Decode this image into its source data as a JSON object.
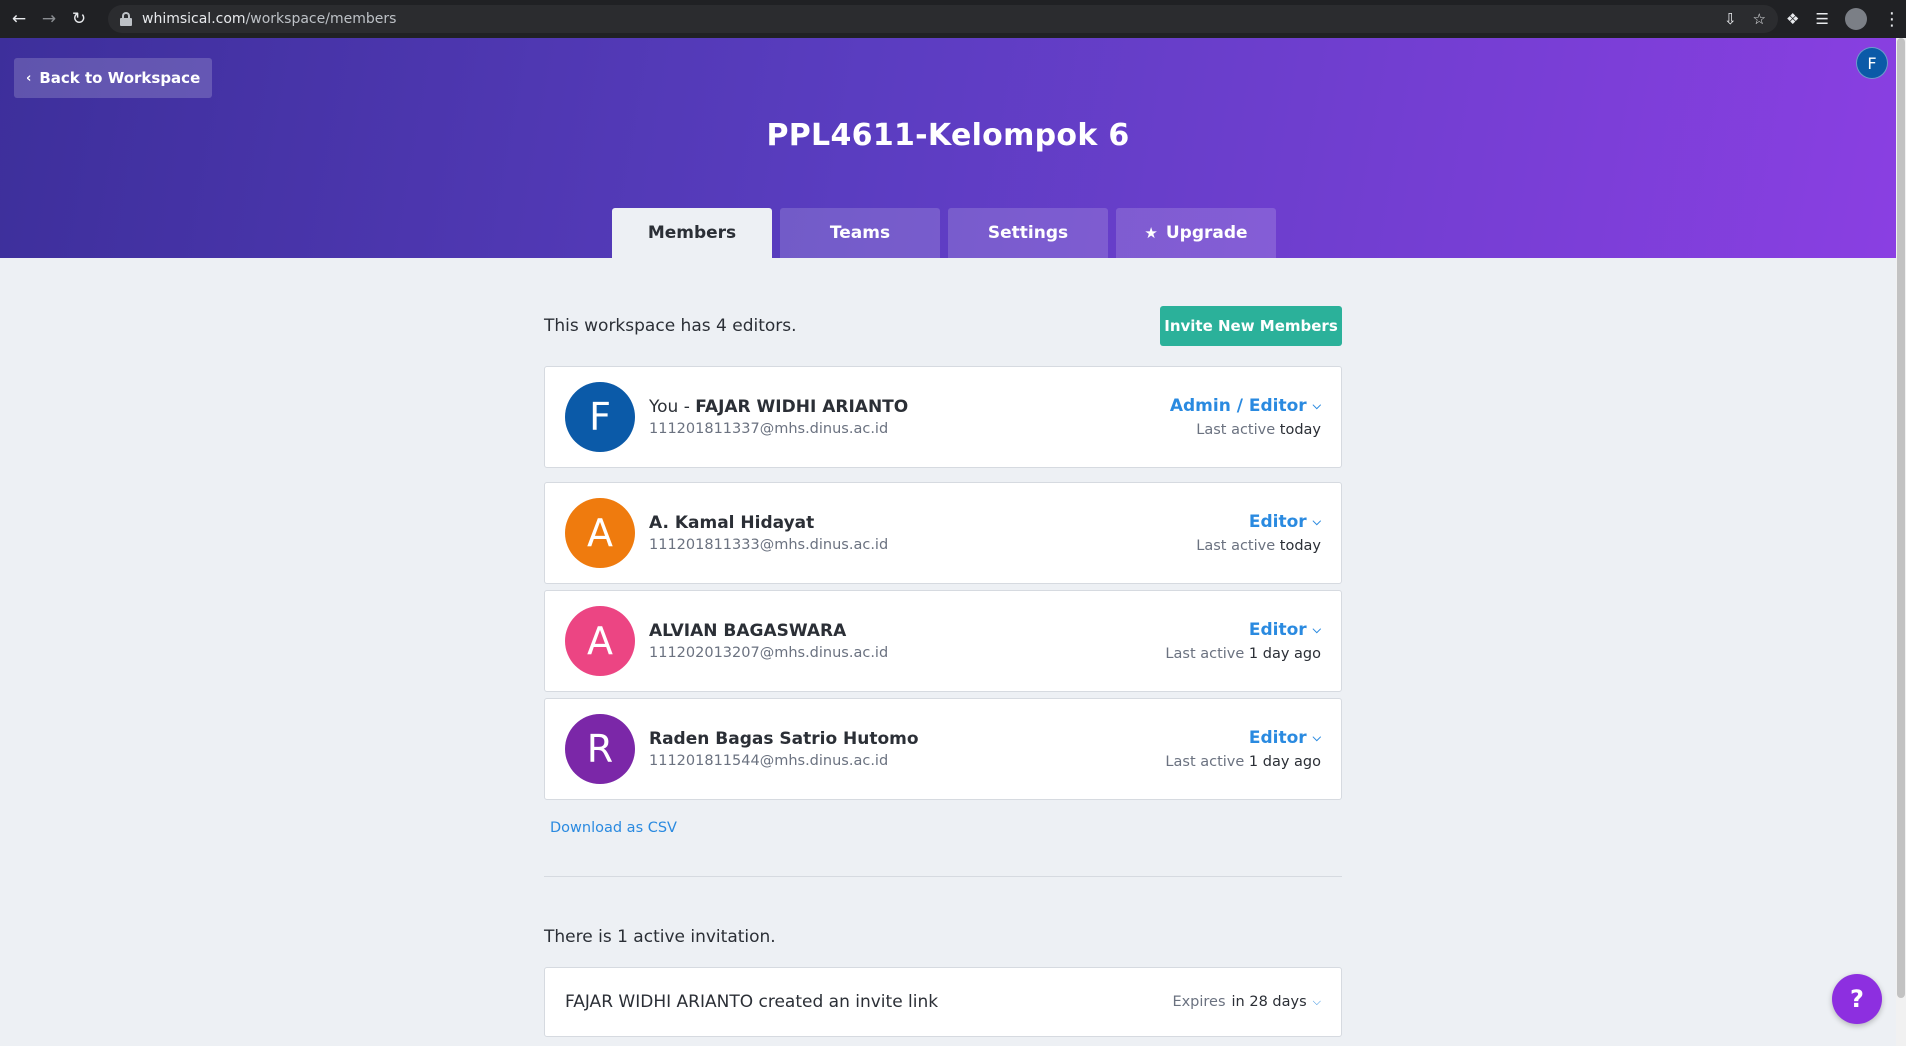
{
  "browser": {
    "url_host": "whimsical.com",
    "url_path": "/workspace/members"
  },
  "header": {
    "back_label": "Back to Workspace",
    "avatar_letter": "F",
    "workspace_title": "PPL4611-Kelompok 6",
    "tabs": [
      {
        "label": "Members",
        "active": true
      },
      {
        "label": "Teams",
        "active": false
      },
      {
        "label": "Settings",
        "active": false
      },
      {
        "label": "Upgrade",
        "active": false
      }
    ]
  },
  "members_section": {
    "summary": "This workspace has 4 editors.",
    "invite_button": "Invite New Members",
    "members": [
      {
        "prefix": "You - ",
        "name": "FAJAR WIDHI ARIANTO",
        "email": "111201811337@mhs.dinus.ac.id",
        "initial": "F",
        "avatar_color": "#0b5aa8",
        "role": "Admin / Editor",
        "last_active_label": "Last active",
        "last_active": "today"
      },
      {
        "prefix": "",
        "name": "A. Kamal Hidayat",
        "email": "111201811333@mhs.dinus.ac.id",
        "initial": "A",
        "avatar_color": "#ef7b0e",
        "role": "Editor",
        "last_active_label": "Last active",
        "last_active": "today"
      },
      {
        "prefix": "",
        "name": "ALVIAN BAGASWARA",
        "email": "111202013207@mhs.dinus.ac.id",
        "initial": "A",
        "avatar_color": "#ec4583",
        "role": "Editor",
        "last_active_label": "Last active",
        "last_active": "1 day ago"
      },
      {
        "prefix": "",
        "name": "Raden Bagas Satrio Hutomo",
        "email": "111201811544@mhs.dinus.ac.id",
        "initial": "R",
        "avatar_color": "#7b27a8",
        "role": "Editor",
        "last_active_label": "Last active",
        "last_active": "1 day ago"
      }
    ],
    "download_csv": "Download as CSV"
  },
  "invitations_section": {
    "summary": "There is 1 active invitation.",
    "invitation": {
      "description": "FAJAR WIDHI ARIANTO created an invite link",
      "expires_label": "Expires",
      "expires_value": "in 28 days"
    }
  },
  "help_label": "?",
  "icons": {
    "back": "arrow-left-icon",
    "forward": "arrow-right-icon",
    "reload": "reload-icon",
    "lock": "lock-icon",
    "star": "star-icon",
    "caret": "chevron-down-icon",
    "help": "question-icon"
  }
}
